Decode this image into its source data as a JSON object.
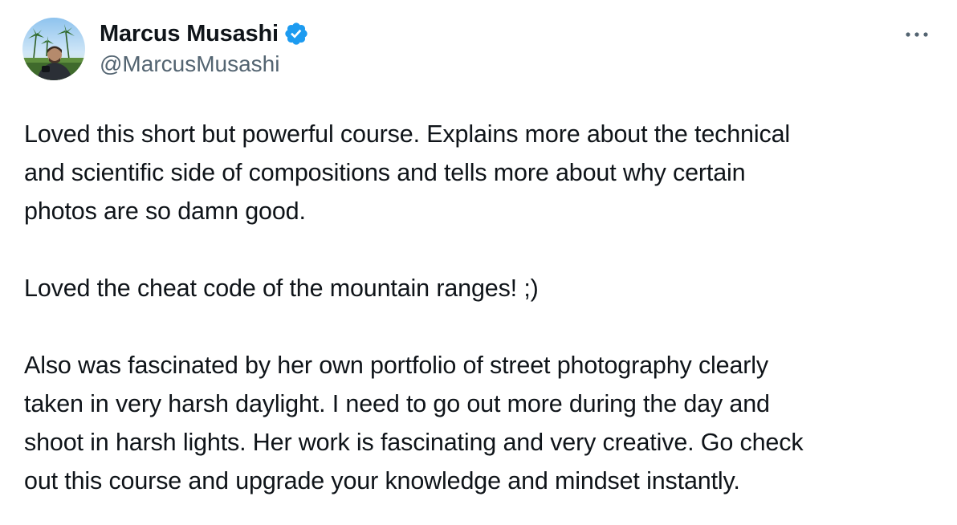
{
  "author": {
    "display_name": "Marcus Musashi",
    "handle": "@MarcusMusashi",
    "verified": true,
    "verified_color": "#1d9bf0"
  },
  "icons": {
    "verified": "verified-badge-icon",
    "more": "more-horizontal-icon"
  },
  "tweet": {
    "paragraphs": [
      [
        "Loved this short but powerful course. Explains more about the technical",
        "and scientific side of compositions and tells more about why certain",
        "photos are so damn good."
      ],
      [
        "Loved the cheat code of the mountain ranges! ;)"
      ],
      [
        "Also was fascinated by her own portfolio of street photography clearly",
        "taken in very harsh daylight. I need to go out more during the day and",
        "shoot in harsh lights. Her work is fascinating and very creative. Go check",
        "out this course and upgrade your knowledge and mindset instantly."
      ]
    ]
  },
  "colors": {
    "text": "#0f1419",
    "secondary": "#536471",
    "accent": "#1d9bf0"
  }
}
